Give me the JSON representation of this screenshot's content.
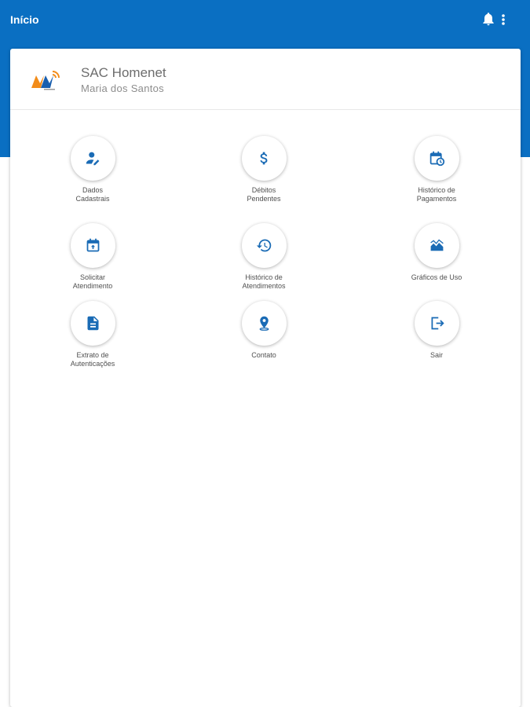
{
  "appbar": {
    "title": "Início",
    "bell_icon": "bell-icon",
    "more_icon": "more-vert-icon",
    "color": "#0a6fc2"
  },
  "header": {
    "app_name": "SAC Homenet",
    "user_name": "Maria dos Santos",
    "logo": "homenet-logo"
  },
  "menu": [
    {
      "label": "Dados\nCadastrais",
      "icon": "user-edit-icon"
    },
    {
      "label": "Débitos\nPendentes",
      "icon": "dollar-icon"
    },
    {
      "label": "Histórico de\nPagamentos",
      "icon": "calendar-clock-icon"
    },
    {
      "label": "Solicitar\nAtendimento",
      "icon": "calendar-upload-icon"
    },
    {
      "label": "Histórico de\nAtendimentos",
      "icon": "history-icon"
    },
    {
      "label": "Gráficos de Uso",
      "icon": "area-chart-icon"
    },
    {
      "label": "Extrato de\nAutenticações",
      "icon": "document-icon"
    },
    {
      "label": "Contato",
      "icon": "location-pin-icon"
    },
    {
      "label": "Sair",
      "icon": "exit-icon"
    }
  ],
  "accent": "#1a6bb5"
}
